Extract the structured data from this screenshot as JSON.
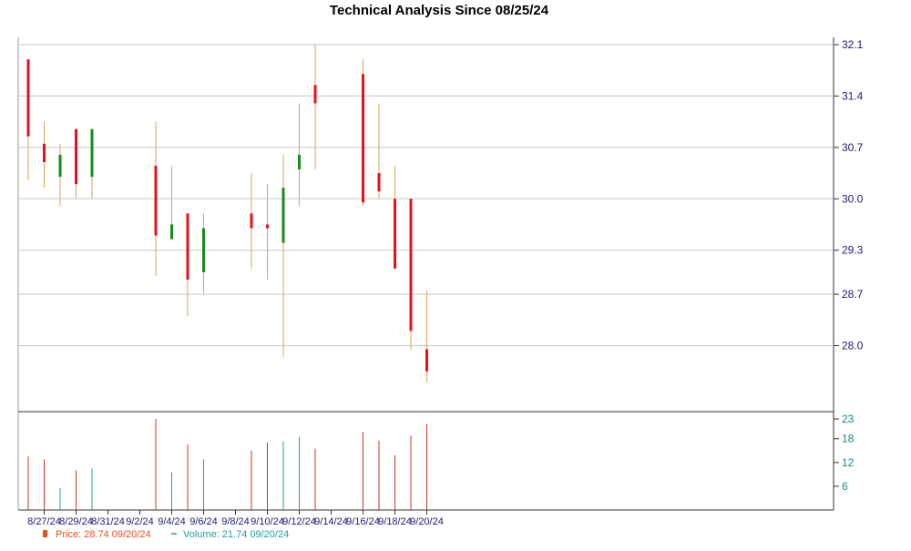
{
  "chart_data": {
    "type": "candlestick",
    "title": "Technical Analysis Since 08/25/24",
    "price_axis": {
      "ylim": [
        27.2,
        32.1
      ],
      "ticks": [
        "32.1",
        "31.4",
        "30.7",
        "30.0",
        "29.3",
        "28.7",
        "28.0"
      ]
    },
    "volume_axis": {
      "ylim": [
        0,
        23
      ],
      "ticks": [
        "23",
        "18",
        "12",
        "6"
      ]
    },
    "x_ticks": [
      "8/27/24",
      "8/29/24",
      "8/31/24",
      "9/2/24",
      "9/4/24",
      "9/6/24",
      "9/8/24",
      "9/10/24",
      "9/12/24",
      "9/14/24",
      "9/16/24",
      "9/18/24",
      "9/20/24"
    ],
    "candles": [
      {
        "date": "8/26/24",
        "open": 31.9,
        "high": 31.9,
        "low": 30.25,
        "close": 30.85,
        "volume": 13.5
      },
      {
        "date": "8/27/24",
        "open": 30.75,
        "high": 31.05,
        "low": 30.15,
        "close": 30.5,
        "volume": 12.8
      },
      {
        "date": "8/28/24",
        "open": 30.3,
        "high": 30.75,
        "low": 29.9,
        "close": 30.6,
        "volume": 5.5
      },
      {
        "date": "8/29/24",
        "open": 30.95,
        "high": 30.95,
        "low": 30.0,
        "close": 30.2,
        "volume": 10.0
      },
      {
        "date": "8/30/24",
        "open": 30.3,
        "high": 30.95,
        "low": 30.0,
        "close": 30.95,
        "volume": 10.5
      },
      {
        "date": "9/3/24",
        "open": 30.45,
        "high": 31.05,
        "low": 28.95,
        "close": 29.5,
        "volume": 23.0
      },
      {
        "date": "9/4/24",
        "open": 29.45,
        "high": 30.45,
        "low": 29.45,
        "close": 29.65,
        "volume": 9.5
      },
      {
        "date": "9/5/24",
        "open": 29.8,
        "high": 29.8,
        "low": 28.4,
        "close": 28.9,
        "volume": 16.5
      },
      {
        "date": "9/6/24",
        "open": 29.0,
        "high": 29.8,
        "low": 28.7,
        "close": 29.6,
        "volume": 12.8
      },
      {
        "date": "9/9/24",
        "open": 29.8,
        "high": 30.35,
        "low": 29.05,
        "close": 29.6,
        "volume": 15.0
      },
      {
        "date": "9/10/24",
        "open": 29.65,
        "high": 30.2,
        "low": 28.9,
        "close": 29.6,
        "volume": 17.0
      },
      {
        "date": "9/11/24",
        "open": 29.4,
        "high": 30.6,
        "low": 27.85,
        "close": 30.15,
        "volume": 17.3
      },
      {
        "date": "9/12/24",
        "open": 30.4,
        "high": 31.3,
        "low": 29.9,
        "close": 30.6,
        "volume": 18.5
      },
      {
        "date": "9/13/24",
        "open": 31.55,
        "high": 32.1,
        "low": 30.4,
        "close": 31.3,
        "volume": 15.5
      },
      {
        "date": "9/16/24",
        "open": 31.7,
        "high": 31.9,
        "low": 29.9,
        "close": 29.95,
        "volume": 19.7
      },
      {
        "date": "9/17/24",
        "open": 30.35,
        "high": 31.3,
        "low": 30.0,
        "close": 30.1,
        "volume": 17.5
      },
      {
        "date": "9/18/24",
        "open": 30.0,
        "high": 30.45,
        "low": 29.05,
        "close": 29.05,
        "volume": 13.8
      },
      {
        "date": "9/19/24",
        "open": 30.0,
        "high": 30.0,
        "low": 27.95,
        "close": 28.2,
        "volume": 18.8
      },
      {
        "date": "9/20/24",
        "open": 27.95,
        "high": 28.75,
        "low": 27.5,
        "close": 27.65,
        "volume": 21.74
      }
    ],
    "grid": true,
    "legend": {
      "price_label": "Price: 28.74  09/20/24",
      "volume_label": "Volume: 21.74  09/20/24"
    }
  },
  "colors": {
    "up": "#1a8a1a",
    "down": "#e8111a",
    "wick": "#d9a55a",
    "volume_up": "#2aa17a",
    "volume_down": "#c0392b",
    "axis_text": "#1a1a7a",
    "volume_text": "#1a8a8a",
    "grid": "#c8c8c8",
    "legend_price": "#e8501a",
    "legend_volume": "#20a0a0"
  }
}
